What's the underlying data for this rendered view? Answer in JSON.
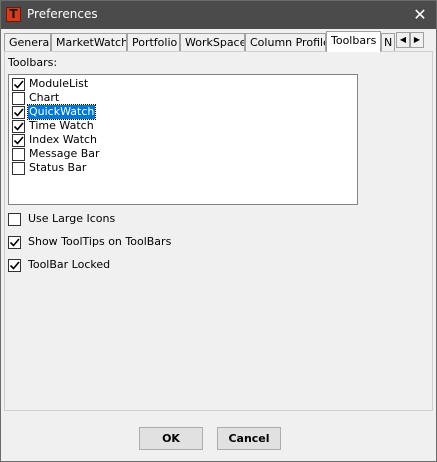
{
  "window": {
    "title": "Preferences",
    "app_icon_letter": "T"
  },
  "tabs": [
    {
      "label": "General",
      "active": false
    },
    {
      "label": "MarketWatch",
      "active": false
    },
    {
      "label": "Portfolio",
      "active": false
    },
    {
      "label": "WorkSpace",
      "active": false
    },
    {
      "label": "Column Profile",
      "active": false
    },
    {
      "label": "Toolbars",
      "active": true
    },
    {
      "label": "N",
      "active": false
    }
  ],
  "toolbars": {
    "group_label": "Toolbars:",
    "items": [
      {
        "label": "ModuleList",
        "checked": true,
        "selected": false
      },
      {
        "label": "Chart",
        "checked": false,
        "selected": false
      },
      {
        "label": "QuickWatch",
        "checked": true,
        "selected": true
      },
      {
        "label": "Time Watch",
        "checked": true,
        "selected": false
      },
      {
        "label": "Index Watch",
        "checked": true,
        "selected": false
      },
      {
        "label": "Message Bar",
        "checked": false,
        "selected": false
      },
      {
        "label": "Status Bar",
        "checked": false,
        "selected": false
      }
    ]
  },
  "options": [
    {
      "label": "Use Large Icons",
      "checked": false
    },
    {
      "label": "Show ToolTips on ToolBars",
      "checked": true
    },
    {
      "label": "ToolBar Locked",
      "checked": true
    }
  ],
  "buttons": {
    "ok": "OK",
    "cancel": "Cancel"
  }
}
